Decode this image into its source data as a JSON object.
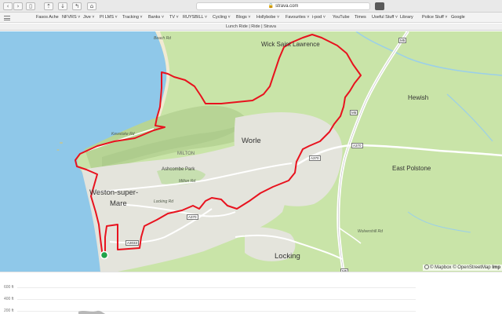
{
  "browser": {
    "url": "strava.com",
    "tab_title": "Lunch Ride | Ride | Strava",
    "bookmarks": [
      {
        "label": "Fasos Ache",
        "dropdown": false
      },
      {
        "label": "NFVRS",
        "dropdown": true
      },
      {
        "label": "Jive",
        "dropdown": true
      },
      {
        "label": "PI LMS",
        "dropdown": true
      },
      {
        "label": "Tracking",
        "dropdown": true
      },
      {
        "label": "Banks",
        "dropdown": true
      },
      {
        "label": "TV",
        "dropdown": true
      },
      {
        "label": "RUYSBILL",
        "dropdown": true
      },
      {
        "label": "Cycling",
        "dropdown": true
      },
      {
        "label": "Blogs",
        "dropdown": true
      },
      {
        "label": "Hollybobe",
        "dropdown": true
      },
      {
        "label": "Favourites",
        "dropdown": true
      },
      {
        "label": "i-pod",
        "dropdown": true
      },
      {
        "label": "YouTube",
        "dropdown": false
      },
      {
        "label": "Times",
        "dropdown": false
      },
      {
        "label": "Useful Stuff",
        "dropdown": true
      },
      {
        "label": "Library",
        "dropdown": false
      },
      {
        "label": "Police Stuff",
        "dropdown": true
      },
      {
        "label": "Google",
        "dropdown": false
      }
    ]
  },
  "map": {
    "places": {
      "wick": "Wick Saint Lawrence",
      "hewish": "Hewish",
      "worle": "Worle",
      "east_polstone": "East Polstone",
      "weston1": "Weston-super-",
      "weston2": "Mare",
      "locking": "Locking",
      "ashcombe": "Ashcombe Park",
      "milton": "MILTON"
    },
    "roads": {
      "m5_a": "M5",
      "m5_b": "M5",
      "m5_c": "M5",
      "a370_a": "A370",
      "a370_b": "A370",
      "a370_c": "A370",
      "a3033": "A3033",
      "milton_rd": "Milton Rd",
      "locking_rd": "Locking Rd",
      "wolvershill_rd": "Wolvershill Rd",
      "kewstoke_rd": "Kewstoke Rd",
      "beach_rd": "Beach Rd"
    },
    "attribution": {
      "mapbox": "© Mapbox",
      "osm": "© OpenStreetMap",
      "improve": "Imp"
    },
    "route_color": "#e8121e",
    "start_color": "#1fa34a"
  },
  "elevation": {
    "labels": [
      "600 ft",
      "400 ft",
      "200 ft"
    ]
  }
}
